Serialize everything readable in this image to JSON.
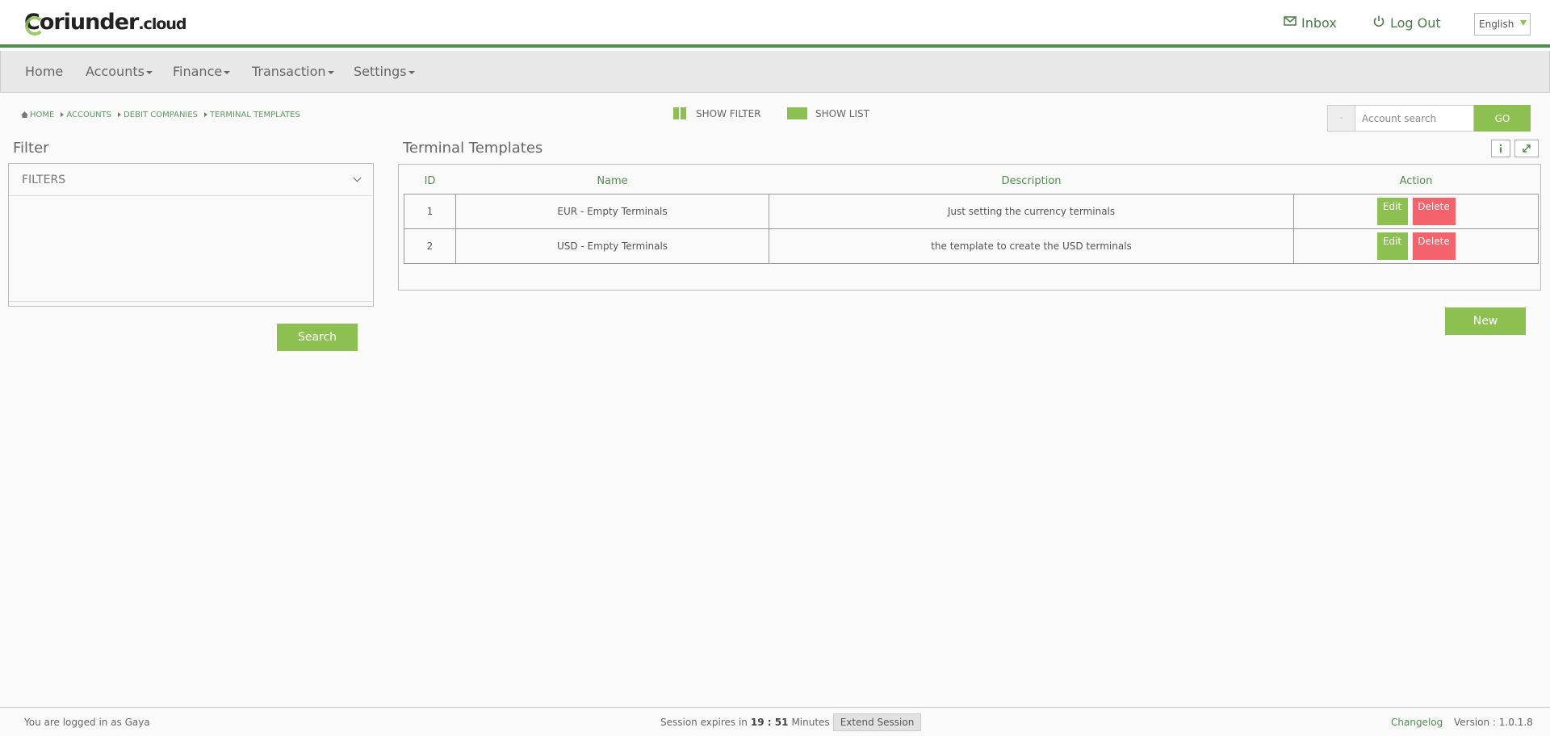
{
  "header": {
    "logo_main": "Coriunder",
    "logo_suffix": ".cloud",
    "inbox_label": "Inbox",
    "logout_label": "Log Out",
    "language": "English"
  },
  "nav": {
    "items": [
      "Home",
      "Accounts",
      "Finance",
      "Transaction",
      "Settings"
    ]
  },
  "breadcrumb": [
    "HOME",
    "ACCOUNTS",
    "DEBIT COMPANIES",
    "TERMINAL TEMPLATES"
  ],
  "toggles": {
    "show_filter": "SHOW FILTER",
    "show_list": "SHOW LIST"
  },
  "account_search": {
    "prefix": "-",
    "placeholder": "Account search",
    "go_label": "GO"
  },
  "filter": {
    "title": "Filter",
    "section_label": "FILTERS",
    "search_label": "Search"
  },
  "list": {
    "title": "Terminal Templates",
    "columns": [
      "ID",
      "Name",
      "Description",
      "Action"
    ],
    "rows": [
      {
        "id": "1",
        "name": "EUR - Empty Terminals",
        "description": "Just setting the currency terminals",
        "edit": "Edit",
        "delete": "Delete"
      },
      {
        "id": "2",
        "name": "USD - Empty Terminals",
        "description": "the template to create the USD terminals",
        "edit": "Edit",
        "delete": "Delete"
      }
    ],
    "new_label": "New"
  },
  "footer": {
    "logged_in": "You are logged in as Gaya",
    "session_prefix": "Session expires in",
    "session_time": "19 : 51",
    "session_suffix": "Minutes",
    "extend_label": "Extend Session",
    "changelog": "Changelog",
    "version": "Version : 1.0.1.8"
  },
  "colors": {
    "accent_green": "#8cc152",
    "header_border": "#4e8f4a",
    "delete_red": "#f4636b"
  }
}
